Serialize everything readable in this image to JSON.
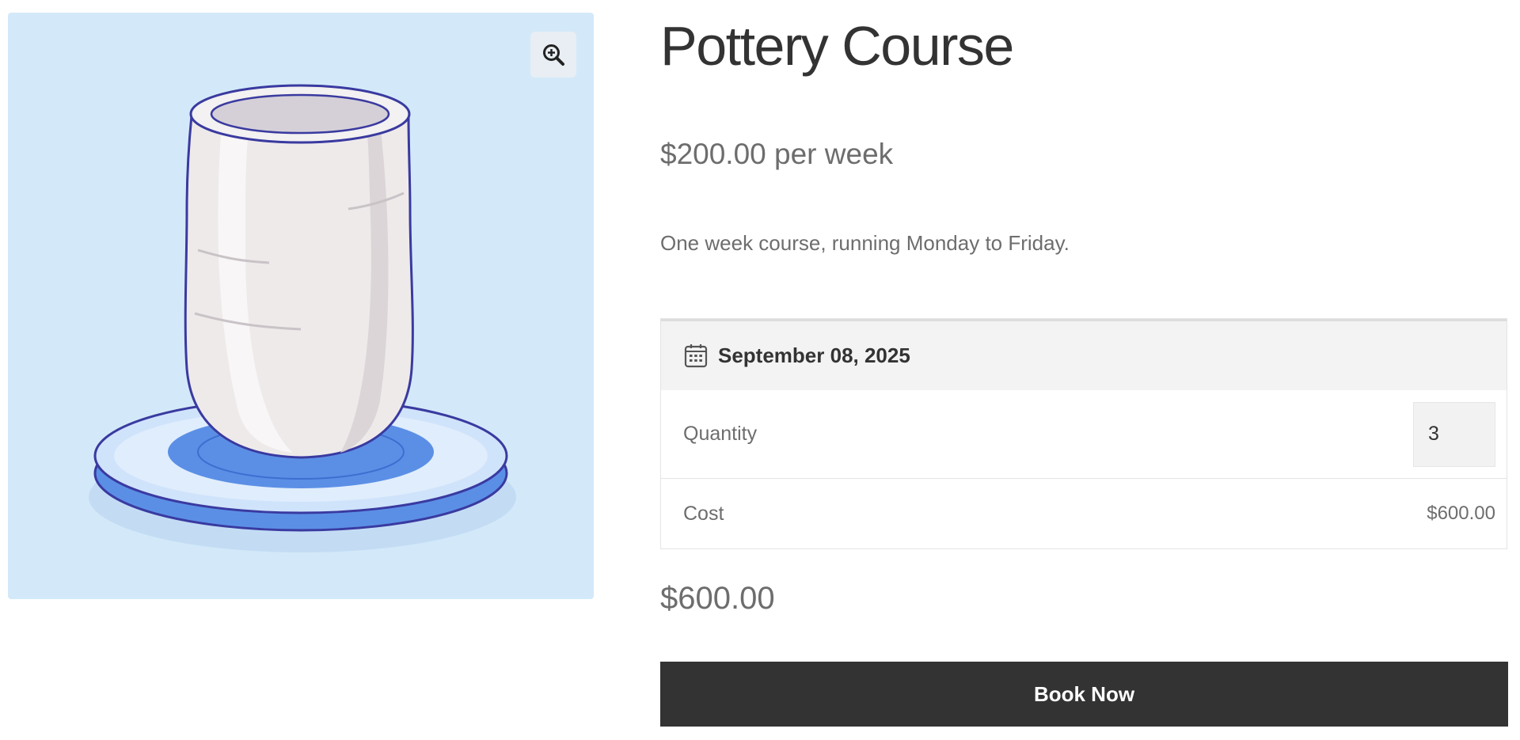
{
  "product": {
    "title": "Pottery Course",
    "price": "$200.00 per week",
    "description": "One week course, running Monday to Friday.",
    "image_alt": "pottery vase on turntable illustration"
  },
  "gallery": {
    "zoom_icon": "magnifier-plus-icon"
  },
  "booking": {
    "date_icon": "calendar-icon",
    "date": "September 08, 2025",
    "quantity_label": "Quantity",
    "quantity_value": "3",
    "cost_label": "Cost",
    "cost_value": "$600.00"
  },
  "total": "$600.00",
  "book_button_label": "Book Now",
  "colors": {
    "image_background": "#d3e9f9",
    "button_background": "#333333",
    "button_text": "#ffffff",
    "accent_blue": "#5b8fe6"
  }
}
